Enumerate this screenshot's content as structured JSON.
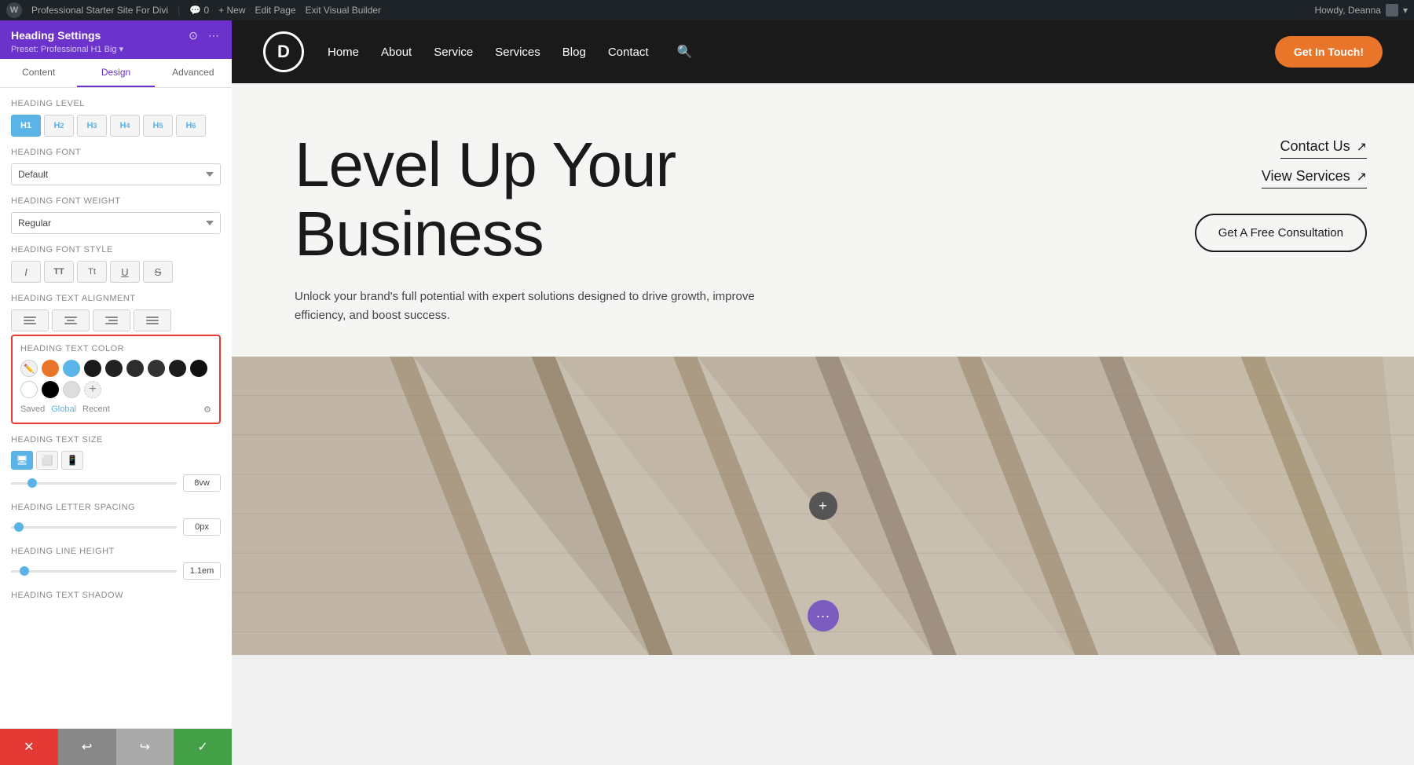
{
  "admin_bar": {
    "wp_logo": "W",
    "site_name": "Professional Starter Site For Divi",
    "comment_count": "0",
    "new_label": "+ New",
    "edit_page_label": "Edit Page",
    "exit_vb_label": "Exit Visual Builder",
    "howdy_label": "Howdy, Deanna"
  },
  "left_panel": {
    "title": "Heading Settings",
    "preset": "Preset: Professional H1 Big ▾",
    "tabs": [
      "Content",
      "Design",
      "Advanced"
    ],
    "active_tab": "Design",
    "sections": {
      "heading_level": {
        "label": "Heading Level",
        "levels": [
          "H1",
          "H2",
          "H3",
          "H4",
          "H5",
          "H6"
        ],
        "active": "H1"
      },
      "heading_font": {
        "label": "Heading Font",
        "value": "Default"
      },
      "heading_font_weight": {
        "label": "Heading Font Weight",
        "value": "Regular"
      },
      "heading_font_style": {
        "label": "Heading Font Style",
        "styles": [
          "I",
          "TT",
          "Tt",
          "U",
          "S"
        ]
      },
      "heading_text_alignment": {
        "label": "Heading Text Alignment",
        "alignments": [
          "left",
          "center",
          "right",
          "justify"
        ]
      },
      "heading_text_color": {
        "label": "Heading Text Color",
        "swatches": [
          {
            "color": "#e8752a"
          },
          {
            "color": "#5bb4e8"
          },
          {
            "color": "#1a1a1a"
          },
          {
            "color": "#222222"
          },
          {
            "color": "#2a2a2a"
          },
          {
            "color": "#333333"
          },
          {
            "color": "#1c1c1c"
          },
          {
            "color": "#ffffff"
          },
          {
            "color": "#f5f5f5"
          },
          {
            "color": "#000000"
          },
          {
            "color": "#cccccc"
          }
        ],
        "tabs": [
          "Saved",
          "Global",
          "Recent"
        ],
        "active_tab": "Global"
      },
      "heading_text_size": {
        "label": "Heading Text Size",
        "value": "8vw"
      },
      "heading_letter_spacing": {
        "label": "Heading Letter Spacing",
        "value": "0px"
      },
      "heading_line_height": {
        "label": "Heading Line Height",
        "value": "1.1em"
      },
      "heading_text_shadow": {
        "label": "Heading Text Shadow"
      }
    }
  },
  "footer_buttons": {
    "cancel": "✕",
    "undo": "↩",
    "redo": "↪",
    "save": "✓"
  },
  "site_nav": {
    "logo_letter": "D",
    "links": [
      "Home",
      "About",
      "Service",
      "Services",
      "Blog",
      "Contact"
    ],
    "cta_label": "Get In Touch!"
  },
  "hero": {
    "heading_line1": "Level Up Your",
    "heading_line2": "Business",
    "subtext": "Unlock your brand's full potential with expert solutions designed to drive growth, improve efficiency, and boost success.",
    "link1_label": "Contact Us",
    "link1_arrow": "↗",
    "link2_label": "View Services",
    "link2_arrow": "↗",
    "cta_label": "Get A Free Consultation"
  },
  "panel_header_icons": {
    "sync": "⊙",
    "more": "⋯"
  }
}
